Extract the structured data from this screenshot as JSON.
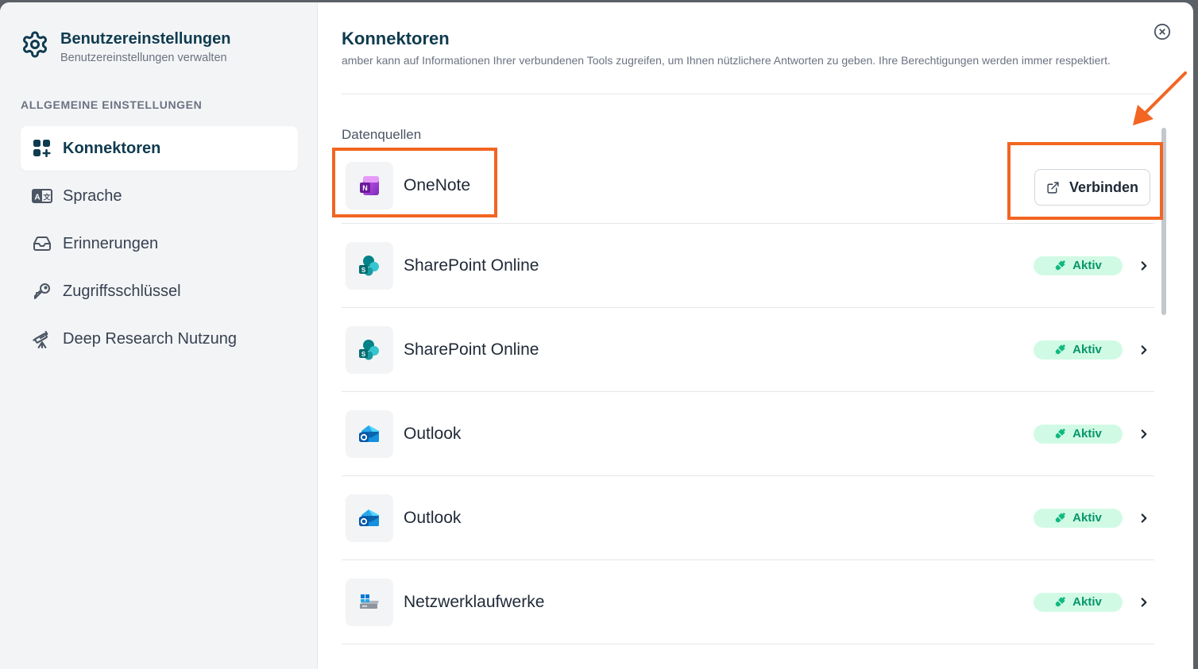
{
  "sidebar": {
    "title": "Benutzereinstellungen",
    "subtitle": "Benutzereinstellungen verwalten",
    "section": "ALLGEMEINE EINSTELLUNGEN",
    "items": [
      {
        "label": "Konnektoren",
        "icon": "connectors-grid-icon",
        "active": true
      },
      {
        "label": "Sprache",
        "icon": "language-icon",
        "active": false
      },
      {
        "label": "Erinnerungen",
        "icon": "inbox-icon",
        "active": false
      },
      {
        "label": "Zugriffsschlüssel",
        "icon": "key-icon",
        "active": false
      },
      {
        "label": "Deep Research Nutzung",
        "icon": "telescope-icon",
        "active": false
      }
    ]
  },
  "main": {
    "title": "Konnektoren",
    "description": "amber kann auf Informationen Ihrer verbundenen Tools zugreifen, um Ihnen nützlichere Antworten zu geben. Ihre Berechtigungen werden immer respektiert.",
    "section_label": "Datenquellen",
    "connect_label": "Verbinden",
    "status_label": "Aktiv",
    "sources": [
      {
        "name": "OneNote",
        "icon": "onenote-icon",
        "connected": false
      },
      {
        "name": "SharePoint Online",
        "icon": "sharepoint-icon",
        "connected": true
      },
      {
        "name": "SharePoint Online",
        "icon": "sharepoint-icon",
        "connected": true
      },
      {
        "name": "Outlook",
        "icon": "outlook-icon",
        "connected": true
      },
      {
        "name": "Outlook",
        "icon": "outlook-icon",
        "connected": true
      },
      {
        "name": "Netzwerklaufwerke",
        "icon": "network-drive-icon",
        "connected": true
      }
    ]
  },
  "colors": {
    "accent": "#0f3b4f",
    "active_bg": "#d1fae5",
    "active_text": "#059669",
    "annotation": "#f26522"
  }
}
